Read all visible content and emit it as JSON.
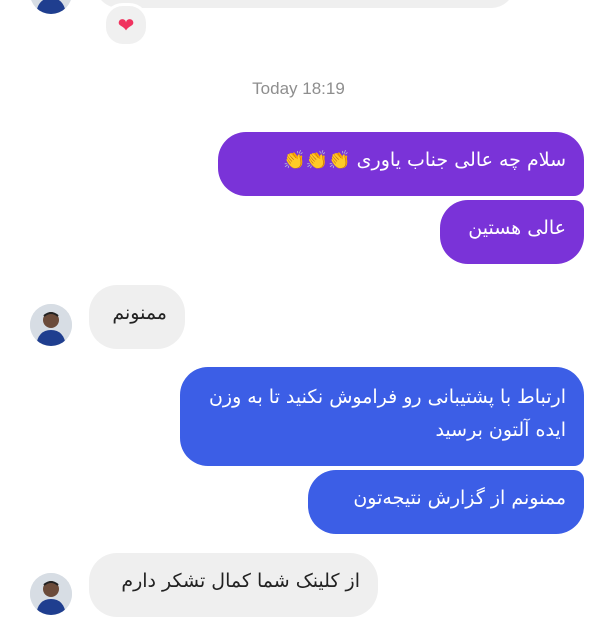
{
  "reaction": {
    "icon": "heart-icon",
    "glyph": "❤"
  },
  "timestamp": "Today 18:19",
  "messages": [
    {
      "sender": "self",
      "text": "سلام چه عالی جناب یاوری",
      "emoji": "👏👏👏"
    },
    {
      "sender": "self",
      "text": "عالی هستین"
    },
    {
      "sender": "other",
      "text": "ممنونم"
    },
    {
      "sender": "self",
      "text": "ارتباط با پشتیبانی رو فراموش نکنید تا به وزن ایده آلتون برسید"
    },
    {
      "sender": "self",
      "text": "ممنونم از گزارش نتیجه‌تون"
    },
    {
      "sender": "other",
      "text": "از کلینک شما کمال تشکر دارم"
    }
  ],
  "colors": {
    "purple": "#7a33d8",
    "blue": "#3c5ee6",
    "incoming": "#efefef",
    "heart": "#f0335f"
  }
}
